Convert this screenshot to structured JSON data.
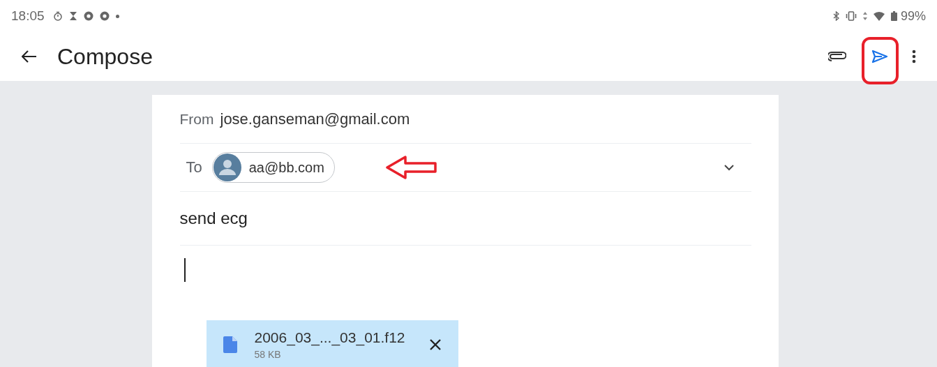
{
  "status_bar": {
    "time": "18:05",
    "battery": "99%"
  },
  "app_bar": {
    "title": "Compose"
  },
  "compose": {
    "from_label": "From",
    "from": "jose.ganseman@gmail.com",
    "to_label": "To",
    "recipients": [
      {
        "address": "aa@bb.com"
      }
    ],
    "subject": "send ecg",
    "attachments": [
      {
        "name": "2006_03_..._03_01.f12",
        "size": "58 KB"
      }
    ]
  }
}
